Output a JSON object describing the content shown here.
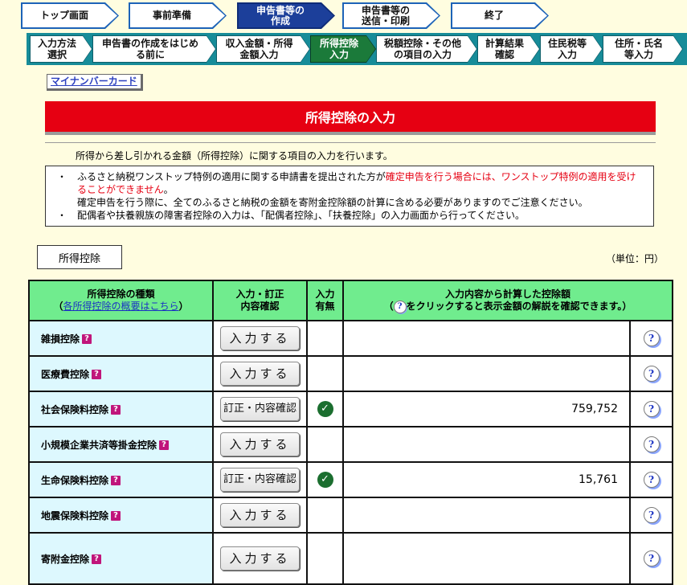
{
  "top_steps": [
    {
      "label": "トップ画面",
      "active": false
    },
    {
      "label": "事前準備",
      "active": false
    },
    {
      "label": "申告書等の\n作成",
      "active": true
    },
    {
      "label": "申告書等の\n送信・印刷",
      "active": false
    },
    {
      "label": "終了",
      "active": false
    }
  ],
  "sub_steps": [
    {
      "label": "入力方法\n選択",
      "active": false
    },
    {
      "label": "申告書の作成をはじめ\nる前に",
      "active": false
    },
    {
      "label": "収入金額・所得\n金額入力",
      "active": false
    },
    {
      "label": "所得控除\n入力",
      "active": true
    },
    {
      "label": "税額控除・その他\nの項目の入力",
      "active": false
    },
    {
      "label": "計算結果\n確認",
      "active": false
    },
    {
      "label": "住民税等\n入力",
      "active": false
    },
    {
      "label": "住所・氏名\n等入力",
      "active": false
    }
  ],
  "mynumber_link": "マイナンバーカード",
  "page_title": "所得控除の入力",
  "intro": "所得から差し引かれる金額（所得控除）に関する項目の入力を行います。",
  "notes": {
    "bullet": "・",
    "line1_black": "ふるさと納税ワンストップ特例の適用に関する申請書を提出された方が",
    "line1_red": "確定申告を行う場合には、ワンストップ特例の適用を受けることができません",
    "line1_end": "。",
    "line2": "確定申告を行う際に、全てのふるさと納税の金額を寄附金控除額の計算に含める必要がありますのでご注意ください。",
    "line3": "配偶者や扶養親族の障害者控除の入力は、「配偶者控除」、「扶養控除」の入力画面から行ってください。"
  },
  "section_label": "所得控除",
  "unit_label": "（単位：円）",
  "table": {
    "header_kind": "所得控除の種類",
    "header_kind_link_open": "（",
    "header_kind_link": "各所得控除の概要はこちら",
    "header_kind_link_close": "）",
    "header_input": "入力・訂正\n内容確認",
    "header_presence": "入力\n有無",
    "header_amount_line1": "入力内容から計算した控除額",
    "header_amount_pre": "（",
    "header_amount_post": "をクリックすると表示金額の解説を確認できます。）",
    "help_glyph": "?",
    "question_glyph": "?",
    "check_glyph": "✓",
    "rows": [
      {
        "kind": "雑損控除",
        "button": "入力する",
        "entered": false,
        "amount": ""
      },
      {
        "kind": "医療費控除",
        "button": "入力する",
        "entered": false,
        "amount": ""
      },
      {
        "kind": "社会保険料控除",
        "button": "訂正・内容確認",
        "entered": true,
        "amount": "759,752"
      },
      {
        "kind": "小規模企業共済等掛金控除",
        "button": "入力する",
        "entered": false,
        "amount": ""
      },
      {
        "kind": "生命保険料控除",
        "button": "訂正・内容確認",
        "entered": true,
        "amount": "15,761"
      },
      {
        "kind": "地震保険料控除",
        "button": "入力する",
        "entered": false,
        "amount": ""
      },
      {
        "kind": "寄附金控除",
        "button": "入力する",
        "entered": false,
        "amount": ""
      }
    ]
  },
  "colors": {
    "background": "#fffde0",
    "title_red": "#e60012",
    "header_green": "#70ec8e",
    "kind_cell_blue": "#ddf8fe",
    "active_top_step": "#1c3f9a",
    "active_sub_step": "#1b7a3a"
  }
}
